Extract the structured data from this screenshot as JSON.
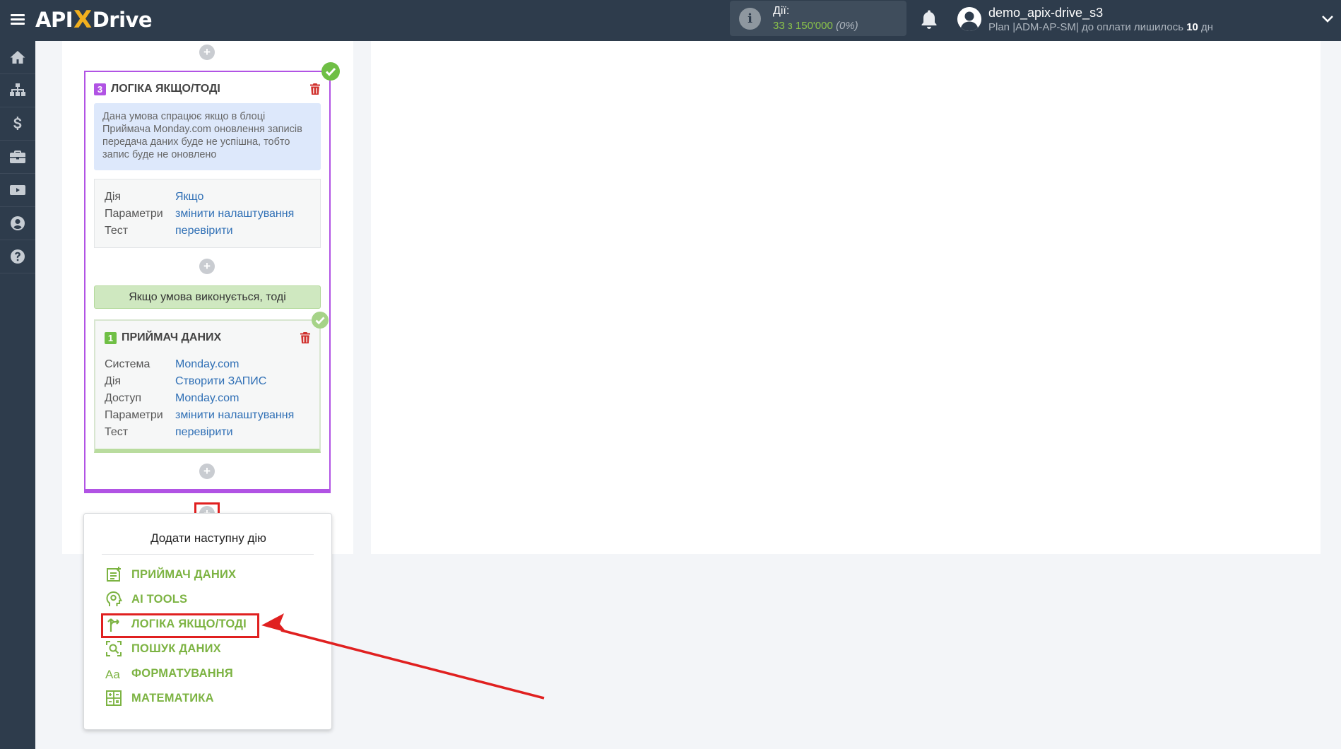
{
  "header": {
    "logo_left": "API",
    "logo_x": "X",
    "logo_right": "Drive",
    "actions_label": "Дії:",
    "actions_count": "33 з 150'000",
    "actions_percent": "(0%)",
    "user_name": "demo_apix-drive_s3",
    "plan_prefix": "Plan |ADM-AP-SM| до оплати лишилось",
    "plan_days": "10",
    "plan_suffix": "дн"
  },
  "sidebar": {
    "items": [
      "home-icon",
      "sitemap-icon",
      "dollar-icon",
      "briefcase-icon",
      "youtube-icon",
      "user-circle-icon",
      "help-icon"
    ]
  },
  "logic_block": {
    "number": "3",
    "title": "ЛОГІКА ЯКЩО/ТОДІ",
    "note": "Дана умова спрацює якщо в блоці Приймача Monday.com оновлення записів передача даних буде не успішна, тобто запис буде не оновлено",
    "rows": [
      {
        "key": "Дія",
        "value": "Якщо"
      },
      {
        "key": "Параметри",
        "value": "змінити налаштування"
      },
      {
        "key": "Тест",
        "value": "перевірити"
      }
    ],
    "condition_label": "Якщо умова виконується, тоді"
  },
  "receiver_block": {
    "number": "1",
    "title": "ПРИЙМАЧ ДАНИХ",
    "rows": [
      {
        "key": "Система",
        "value": "Monday.com"
      },
      {
        "key": "Дія",
        "value": "Створити ЗАПИС"
      },
      {
        "key": "Доступ",
        "value": "Monday.com"
      },
      {
        "key": "Параметри",
        "value": "змінити налаштування"
      },
      {
        "key": "Тест",
        "value": "перевірити"
      }
    ]
  },
  "add_menu": {
    "title": "Додати наступну дію",
    "items": [
      {
        "label": "ПРИЙМАЧ ДАНИХ",
        "icon": "receiver-icon"
      },
      {
        "label": "AI TOOLS",
        "icon": "ai-head-icon"
      },
      {
        "label": "ЛОГІКА ЯКЩО/ТОДІ",
        "icon": "branch-icon"
      },
      {
        "label": "ПОШУК ДАНИХ",
        "icon": "search-data-icon"
      },
      {
        "label": "ФОРМАТУВАННЯ",
        "icon": "format-text-icon"
      },
      {
        "label": "МАТЕМАТИКА",
        "icon": "calculator-icon"
      }
    ]
  },
  "colors": {
    "topbar": "#2e3c4c",
    "logic_accent": "#b153e4",
    "green_accent": "#7cb342",
    "link": "#2f6fb5",
    "highlight_red": "#e02020"
  }
}
